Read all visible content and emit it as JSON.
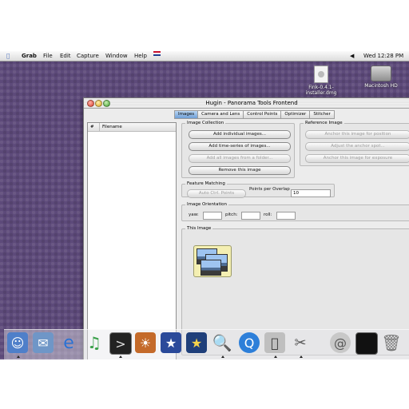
{
  "menubar": {
    "app": "Grab",
    "items": [
      "File",
      "Edit",
      "Capture",
      "Window",
      "Help"
    ],
    "clock": "Wed 12:28 PM"
  },
  "desktop": {
    "icons": [
      {
        "label": "Fink-0.4.1-installer.dmg"
      },
      {
        "label": "Macintosh HD"
      }
    ]
  },
  "window": {
    "title": "Hugin - Panorama Tools Frontend",
    "tabs": [
      "Images",
      "Camera and Lens",
      "Control Points",
      "Optimizer",
      "Stitcher"
    ],
    "active_tab": "Images",
    "list": {
      "col_num": "#",
      "col_filename": "Filename"
    },
    "image_collection": {
      "legend": "Image Collection",
      "add_individual": "Add individual images...",
      "add_series": "Add time-series of images...",
      "add_folder": "Add all images from a folder...",
      "remove": "Remove this image"
    },
    "reference_image": {
      "legend": "Reference Image",
      "anchor_position": "Anchor this image for position",
      "adjust_anchor": "Adjust the anchor spot...",
      "anchor_exposure": "Anchor this image for exposure"
    },
    "feature_matching": {
      "legend": "Feature Matching",
      "auto_ctrl": "Auto Ctrl. Points",
      "points_label": "Points per Overlap",
      "points_value": "10"
    },
    "orientation": {
      "legend": "Image Orientation",
      "yaw": "yaw:",
      "pitch": "pitch:",
      "roll": "roll:"
    },
    "this_image": {
      "legend": "This Image"
    }
  },
  "dock": {
    "icons": [
      "finder-icon",
      "mail-icon",
      "internet-explorer-icon",
      "itunes-icon",
      "terminal-icon",
      "iphoto-icon",
      "imovie-icon",
      "idvd-icon",
      "preview-icon",
      "quicktime-icon",
      "system-preferences-icon",
      "hugin-icon",
      "safari-icon",
      "console-icon",
      "trash-icon"
    ]
  }
}
